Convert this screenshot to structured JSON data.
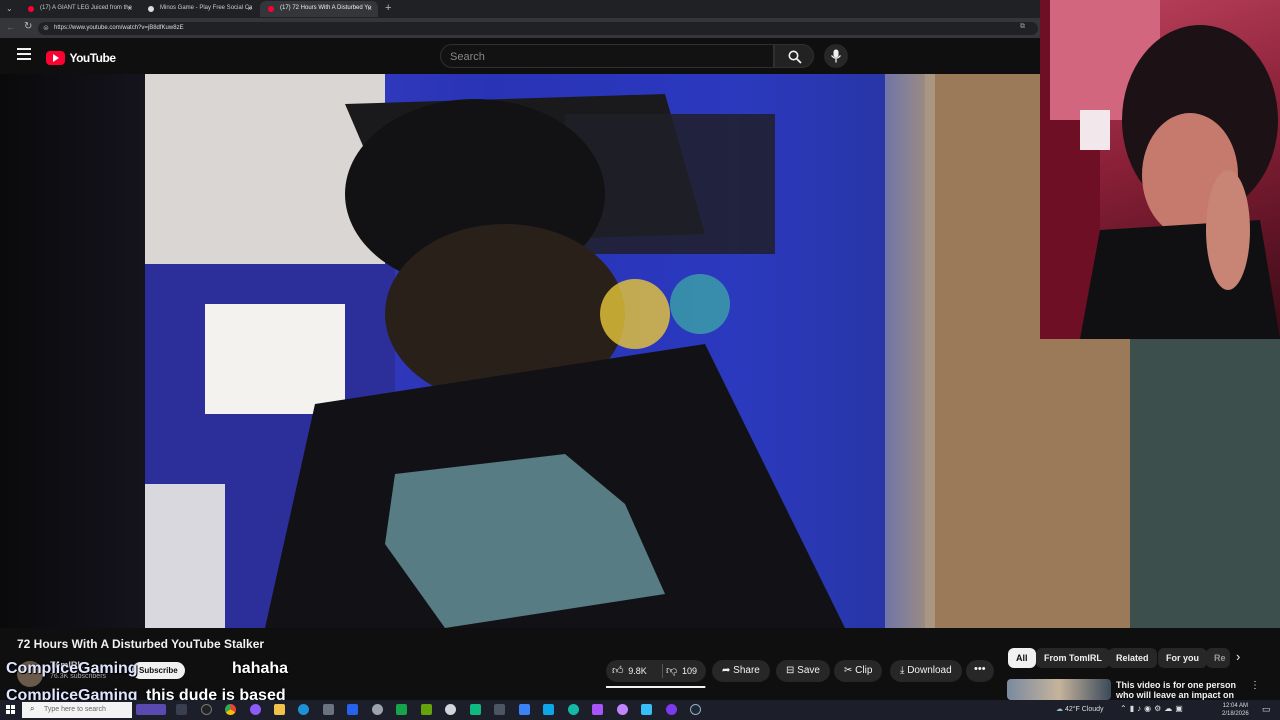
{
  "browser": {
    "tabs": [
      {
        "label": "(17) A GIANT LEG Juiced from the",
        "color": "#ff0033"
      },
      {
        "label": "Minos Game - Play Free Social Ca",
        "color": "#dddddd"
      },
      {
        "label": "(17) 72 Hours With A Disturbed Yo",
        "color": "#ff0033"
      }
    ],
    "url": "https://www.youtube.com/watch?v=jB8dfKuw8zE"
  },
  "youtube": {
    "logo_text": "YouTube",
    "search_placeholder": "Search"
  },
  "video": {
    "title": "72 Hours With A Disturbed YouTube Stalker",
    "channel": "TomIRL",
    "subscribers": "76.3K subscribers",
    "subscribe_label": "Subscribe"
  },
  "actions": {
    "likes": "9.8K",
    "dislikes": "109",
    "share": "Share",
    "save": "Save",
    "clip": "Clip",
    "download": "Download"
  },
  "chips": [
    "All",
    "From TomIRL",
    "Related",
    "For you",
    "Re"
  ],
  "recommendation": {
    "line1": "This video is for one person",
    "line2": "who will leave an impact on th"
  },
  "chat": [
    {
      "user": "CompliceGaming",
      "message": "hahaha"
    },
    {
      "user": "CompliceGaming",
      "message": "this dude is based"
    }
  ],
  "taskbar": {
    "search_placeholder": "Type here to search",
    "weather": "42°F Cloudy",
    "time": "12:04 AM",
    "date": "2/18/2026"
  },
  "colors": {
    "brand": "#ff0033",
    "background": "#0f0f0f",
    "chip_active": "#f1f1f1"
  }
}
